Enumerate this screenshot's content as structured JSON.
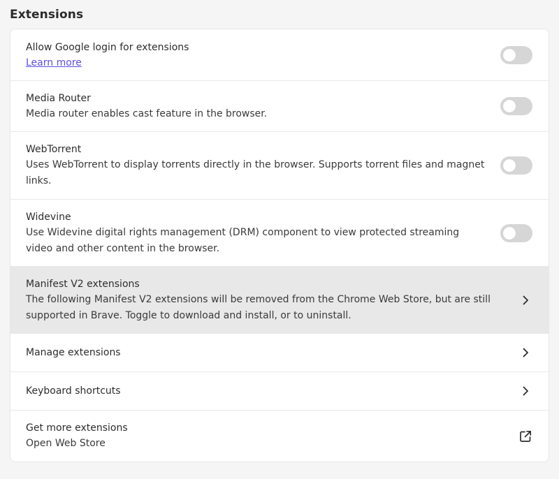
{
  "section": {
    "title": "Extensions"
  },
  "rows": [
    {
      "label": "Allow Google login for extensions",
      "link": "Learn more",
      "control": "toggle",
      "enabled": false
    },
    {
      "label": "Media Router",
      "description": "Media router enables cast feature in the browser.",
      "control": "toggle",
      "enabled": false
    },
    {
      "label": "WebTorrent",
      "description": "Uses WebTorrent to display torrents directly in the browser. Supports torrent files and magnet links.",
      "control": "toggle",
      "enabled": false
    },
    {
      "label": "Widevine",
      "description": "Use Widevine digital rights management (DRM) component to view protected streaming video and other content in the browser.",
      "control": "toggle",
      "enabled": false
    },
    {
      "label": "Manifest V2 extensions",
      "description": "The following Manifest V2 extensions will be removed from the Chrome Web Store, but are still supported in Brave. Toggle to download and install, or to uninstall.",
      "control": "chevron-right-icon"
    },
    {
      "label": "Manage extensions",
      "control": "chevron-right-icon"
    },
    {
      "label": "Keyboard shortcuts",
      "control": "chevron-right-icon"
    },
    {
      "label": "Get more extensions",
      "description": "Open Web Store",
      "control": "external-link-icon"
    }
  ],
  "colors": {
    "page_background": "#f5f5f5",
    "card_background": "#ffffff",
    "hover_row": "#e8e8e8",
    "link": "#5b4fe0",
    "toggle_off": "#d6d6d6"
  }
}
